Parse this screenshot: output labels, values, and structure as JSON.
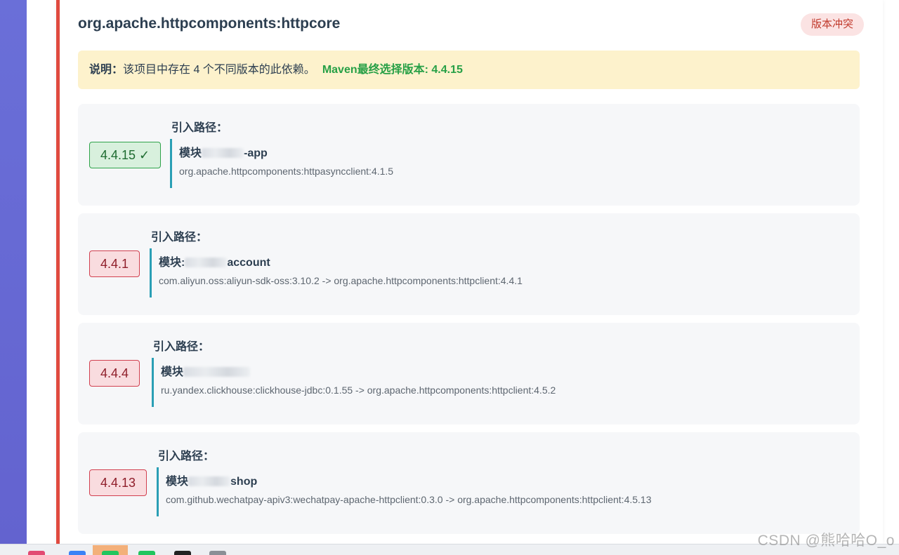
{
  "card": {
    "title": "org.apache.httpcomponents:httpcore",
    "badge": "版本冲突"
  },
  "notice": {
    "label": "说明：",
    "text": "该项目中存在 4 个不同版本的此依赖。",
    "selected": "Maven最终选择版本: 4.4.15"
  },
  "items": [
    {
      "version": "4.4.15 ✓",
      "path_title": "引入路径：",
      "module_prefix": "模块",
      "module_suffix": "-app",
      "dependency": "org.apache.httpcomponents:httpasyncclient:4.1.5"
    },
    {
      "version": "4.4.1",
      "path_title": "引入路径：",
      "module_prefix": "模块:",
      "module_suffix": "account",
      "dependency": "com.aliyun.oss:aliyun-sdk-oss:3.10.2 -> org.apache.httpcomponents:httpclient:4.4.1"
    },
    {
      "version": "4.4.4",
      "path_title": "引入路径：",
      "module_prefix": "模块",
      "module_suffix": "",
      "dependency": "ru.yandex.clickhouse:clickhouse-jdbc:0.1.55 -> org.apache.httpcomponents:httpclient:4.5.2"
    },
    {
      "version": "4.4.13",
      "path_title": "引入路径：",
      "module_prefix": "模块",
      "module_suffix": "shop",
      "dependency": "com.github.wechatpay-apiv3:wechatpay-apache-httpclient:0.3.0 -> org.apache.httpcomponents:httpclient:4.5.13"
    }
  ],
  "watermark": "CSDN @熊哈哈O_o",
  "colors": {
    "accent_border": "#e04a3f",
    "selected_green": "#27a046",
    "path_border": "#2a9fb5",
    "sidebar": "#6a6fd8"
  }
}
